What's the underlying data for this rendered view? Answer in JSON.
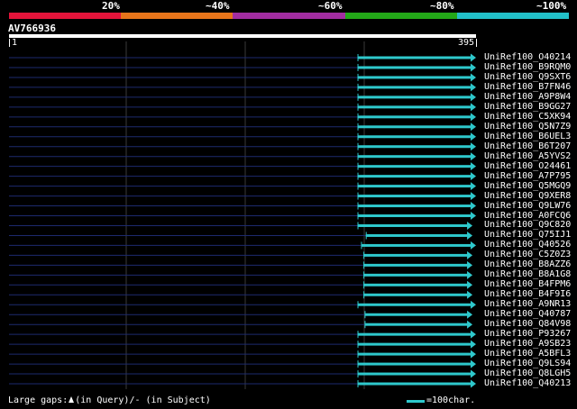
{
  "legend": {
    "colors": [
      "#e3143a",
      "#e8751a",
      "#a22da1",
      "#23a818",
      "#22c0c8"
    ],
    "labels": [
      "20%",
      "~40%",
      "~60%",
      "~80%",
      "~100%"
    ]
  },
  "query": {
    "id": "AV766936",
    "start": "1",
    "end": "395",
    "length": 395
  },
  "colors": {
    "background": "#000000",
    "hit": "#2ec8cc",
    "hit_left": "#1d2a6e",
    "grid": "#3a3a3a",
    "text": "#ffffff"
  },
  "hits": [
    {
      "name": "UniRef100_O40214",
      "start": 295,
      "end": 395
    },
    {
      "name": "UniRef100_B9RQM0",
      "start": 295,
      "end": 395
    },
    {
      "name": "UniRef100_Q9SXT6",
      "start": 295,
      "end": 395
    },
    {
      "name": "UniRef100_B7FN46",
      "start": 295,
      "end": 395
    },
    {
      "name": "UniRef100_A9P8W4",
      "start": 295,
      "end": 395
    },
    {
      "name": "UniRef100_B9GG27",
      "start": 295,
      "end": 395
    },
    {
      "name": "UniRef100_C5XK94",
      "start": 295,
      "end": 395
    },
    {
      "name": "UniRef100_Q5N7Z9",
      "start": 295,
      "end": 395
    },
    {
      "name": "UniRef100_B6UEL3",
      "start": 295,
      "end": 395
    },
    {
      "name": "UniRef100_B6T207",
      "start": 295,
      "end": 395
    },
    {
      "name": "UniRef100_A5YVS2",
      "start": 295,
      "end": 395
    },
    {
      "name": "UniRef100_O24461",
      "start": 295,
      "end": 395
    },
    {
      "name": "UniRef100_A7P795",
      "start": 295,
      "end": 395
    },
    {
      "name": "UniRef100_Q5MGQ9",
      "start": 295,
      "end": 395
    },
    {
      "name": "UniRef100_Q9XER8",
      "start": 295,
      "end": 395
    },
    {
      "name": "UniRef100_Q9LW76",
      "start": 295,
      "end": 395
    },
    {
      "name": "UniRef100_A0FCQ6",
      "start": 295,
      "end": 395
    },
    {
      "name": "UniRef100_Q9C820",
      "start": 295,
      "end": 392
    },
    {
      "name": "UniRef100_Q75IJ1",
      "start": 302,
      "end": 392
    },
    {
      "name": "UniRef100_Q40526",
      "start": 298,
      "end": 395
    },
    {
      "name": "UniRef100_C5Z0Z3",
      "start": 300,
      "end": 392
    },
    {
      "name": "UniRef100_B8AZZ6",
      "start": 300,
      "end": 392
    },
    {
      "name": "UniRef100_B8A1G8",
      "start": 300,
      "end": 392
    },
    {
      "name": "UniRef100_B4FPM6",
      "start": 300,
      "end": 392
    },
    {
      "name": "UniRef100_B4F9I6",
      "start": 300,
      "end": 392
    },
    {
      "name": "UniRef100_A9NR13",
      "start": 295,
      "end": 395
    },
    {
      "name": "UniRef100_Q40787",
      "start": 301,
      "end": 392
    },
    {
      "name": "UniRef100_Q84V98",
      "start": 301,
      "end": 392
    },
    {
      "name": "UniRef100_P93267",
      "start": 295,
      "end": 395
    },
    {
      "name": "UniRef100_A9SB23",
      "start": 295,
      "end": 395
    },
    {
      "name": "UniRef100_A5BFL3",
      "start": 295,
      "end": 395
    },
    {
      "name": "UniRef100_Q9LS94",
      "start": 295,
      "end": 395
    },
    {
      "name": "UniRef100_Q8LGH5",
      "start": 295,
      "end": 395
    },
    {
      "name": "UniRef100_Q40213",
      "start": 295,
      "end": 395
    }
  ],
  "footer": {
    "gaps_prefix": "Large gaps:",
    "gaps_query": "(in Query)/",
    "gaps_subject": "(in Subject)",
    "scale_label": "=100char."
  }
}
